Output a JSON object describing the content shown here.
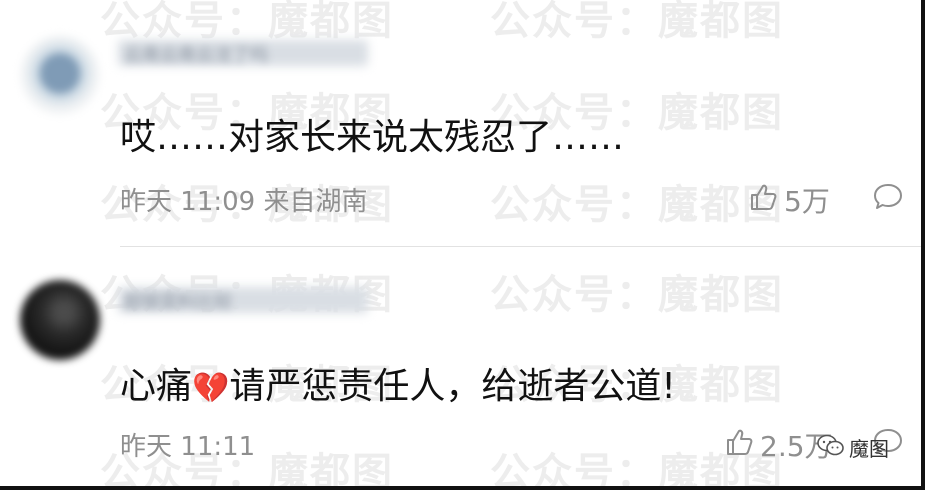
{
  "watermark": {
    "text": "公众号：魔都图"
  },
  "comments": [
    {
      "username": "云南云南云沈了吗",
      "content": "哎……对家长来说太残忍了……",
      "date": "昨天",
      "time": "11:09",
      "location": "来自湖南",
      "likes": "5万",
      "avatar_colors": [
        "#e9edf0",
        "#6d8aa8"
      ]
    },
    {
      "username": "超银菜料比较",
      "content_prefix": "心痛",
      "emoji": "💔",
      "content_suffix": "请严惩责任人，给逝者公道!",
      "date": "昨天",
      "time": "11:11",
      "likes": "2.5万",
      "avatar_colors": [
        "#3a3a3a",
        "#181818"
      ]
    }
  ],
  "badge": {
    "label": "魔图"
  },
  "colors": {
    "meta_text": "#8f8f8f",
    "content_text": "#111111",
    "watermark": "#ededed"
  }
}
